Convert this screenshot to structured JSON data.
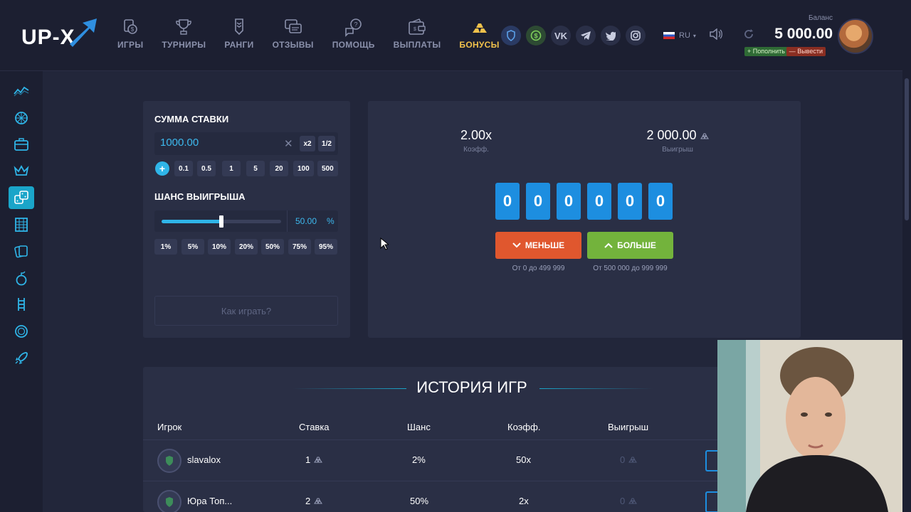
{
  "header": {
    "logo_text": "UP-X",
    "nav": [
      {
        "label": "ИГРЫ",
        "icon": "games-icon"
      },
      {
        "label": "ТУРНИРЫ",
        "icon": "trophy-icon"
      },
      {
        "label": "РАНГИ",
        "icon": "ranks-icon"
      },
      {
        "label": "ОТЗЫВЫ",
        "icon": "reviews-icon"
      },
      {
        "label": "ПОМОЩЬ",
        "icon": "help-icon"
      },
      {
        "label": "ВЫПЛАТЫ",
        "icon": "payouts-icon"
      },
      {
        "label": "БОНУСЫ",
        "icon": "bonuses-icon",
        "active": true
      }
    ],
    "socials": [
      "shield-icon",
      "dollar-icon",
      "vk-icon",
      "telegram-icon",
      "twitter-icon",
      "instagram-icon"
    ],
    "vk_text": "VK",
    "language": "RU",
    "balance_label": "Баланс",
    "balance_value": "5 000.00",
    "topup_label": "Пополнить",
    "withdraw_label": "Вывести",
    "accent_color": "#f0c14b"
  },
  "sidebar": {
    "items": [
      "chart-icon",
      "wheel-icon",
      "case-icon",
      "crown-icon",
      "dice-icon",
      "grid-icon",
      "cards-icon",
      "bomb-icon",
      "ladder-icon",
      "coin-icon",
      "rocket-icon"
    ],
    "active_index": 4
  },
  "bet": {
    "title": "СУММА СТАВКИ",
    "amount": "1000.00",
    "x2_label": "x2",
    "half_label": "1/2",
    "plus_label": "+",
    "chips": [
      "0.1",
      "0.5",
      "1",
      "5",
      "20",
      "100",
      "500"
    ],
    "chance_title": "ШАНС ВЫИГРЫША",
    "chance_value": "50.00",
    "chance_fraction": 0.5,
    "chance_unit": "%",
    "percent_chips": [
      "1%",
      "5%",
      "10%",
      "20%",
      "50%",
      "75%",
      "95%"
    ],
    "howto_label": "Как играть?"
  },
  "game": {
    "coef_value": "2.00x",
    "coef_label": "Коэфф.",
    "win_value": "2 000.00",
    "win_label": "Выигрыш",
    "digits": [
      "0",
      "0",
      "0",
      "0",
      "0",
      "0"
    ],
    "less_label": "МЕНЬШЕ",
    "more_label": "БОЛЬШЕ",
    "less_range": "От 0 до 499 999",
    "more_range": "От 500 000 до 999 999",
    "less_color": "#e0572e",
    "more_color": "#73b33c",
    "digit_color": "#1d8ee0"
  },
  "history": {
    "title": "ИСТОРИЯ ИГР",
    "columns": [
      "Игрок",
      "Ставка",
      "Шанс",
      "Коэфф.",
      "Выигрыш"
    ],
    "rows": [
      {
        "player": "slavalox",
        "bet": "1",
        "chance": "2%",
        "coef": "50x",
        "win": "0"
      },
      {
        "player": "Юра Топ...",
        "bet": "2",
        "chance": "50%",
        "coef": "2x",
        "win": "0"
      }
    ]
  }
}
